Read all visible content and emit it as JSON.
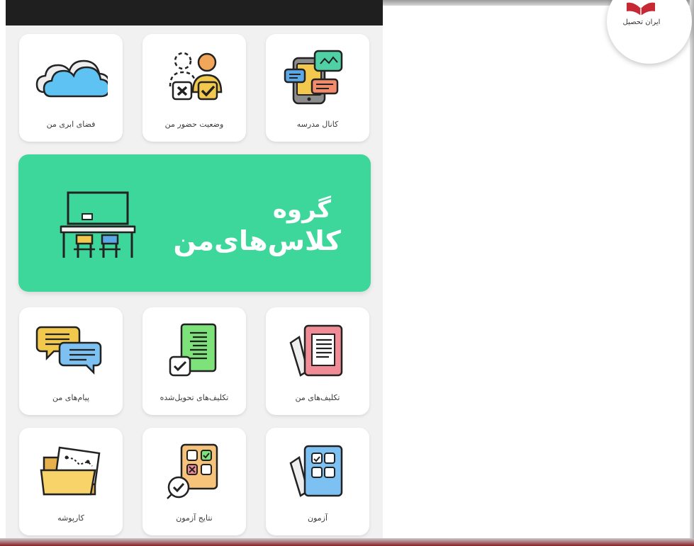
{
  "brand": {
    "name": "ایران تحصیل",
    "color": "#c62834"
  },
  "colors": {
    "banner": "#3ed79b",
    "tile_bg": "#ffffff",
    "panel_bg": "#f1f1f1"
  },
  "grid_top": [
    {
      "label": "کانال مدرسه",
      "icon": "school-channel-icon"
    },
    {
      "label": "وضعیت حضور من",
      "icon": "attendance-status-icon"
    },
    {
      "label": "فضای ابری من",
      "icon": "cloud-storage-icon"
    }
  ],
  "banner": {
    "line1": "گروه",
    "line2": "کلاس‌های‌من",
    "icon": "classroom-icon"
  },
  "grid_mid": [
    {
      "label": "تکلیف‌های من",
      "icon": "my-assignments-icon"
    },
    {
      "label": "تکلیف‌های تحویل‌شده",
      "icon": "submitted-assignments-icon"
    },
    {
      "label": "پیام‌های من",
      "icon": "messages-icon"
    }
  ],
  "grid_bottom": [
    {
      "label": "آزمون",
      "icon": "exam-icon"
    },
    {
      "label": "نتایج آزمون",
      "icon": "exam-results-icon"
    },
    {
      "label": "کارپوشه",
      "icon": "portfolio-folder-icon"
    }
  ]
}
